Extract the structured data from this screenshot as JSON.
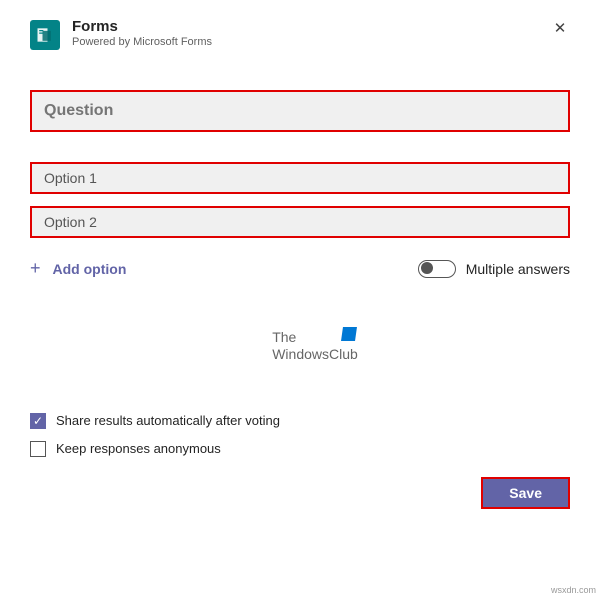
{
  "header": {
    "title": "Forms",
    "subtitle": "Powered by Microsoft Forms"
  },
  "form": {
    "question_placeholder": "Question",
    "options": [
      "Option 1",
      "Option 2"
    ],
    "add_option_label": "Add option",
    "multiple_answers_label": "Multiple answers",
    "multiple_answers_on": false
  },
  "watermark": {
    "line1": "The",
    "line2": "WindowsClub"
  },
  "settings": {
    "share_results": {
      "label": "Share results automatically after voting",
      "checked": true
    },
    "anonymous": {
      "label": "Keep responses anonymous",
      "checked": false
    }
  },
  "actions": {
    "save_label": "Save"
  },
  "footer_note": "wsxdn.com"
}
